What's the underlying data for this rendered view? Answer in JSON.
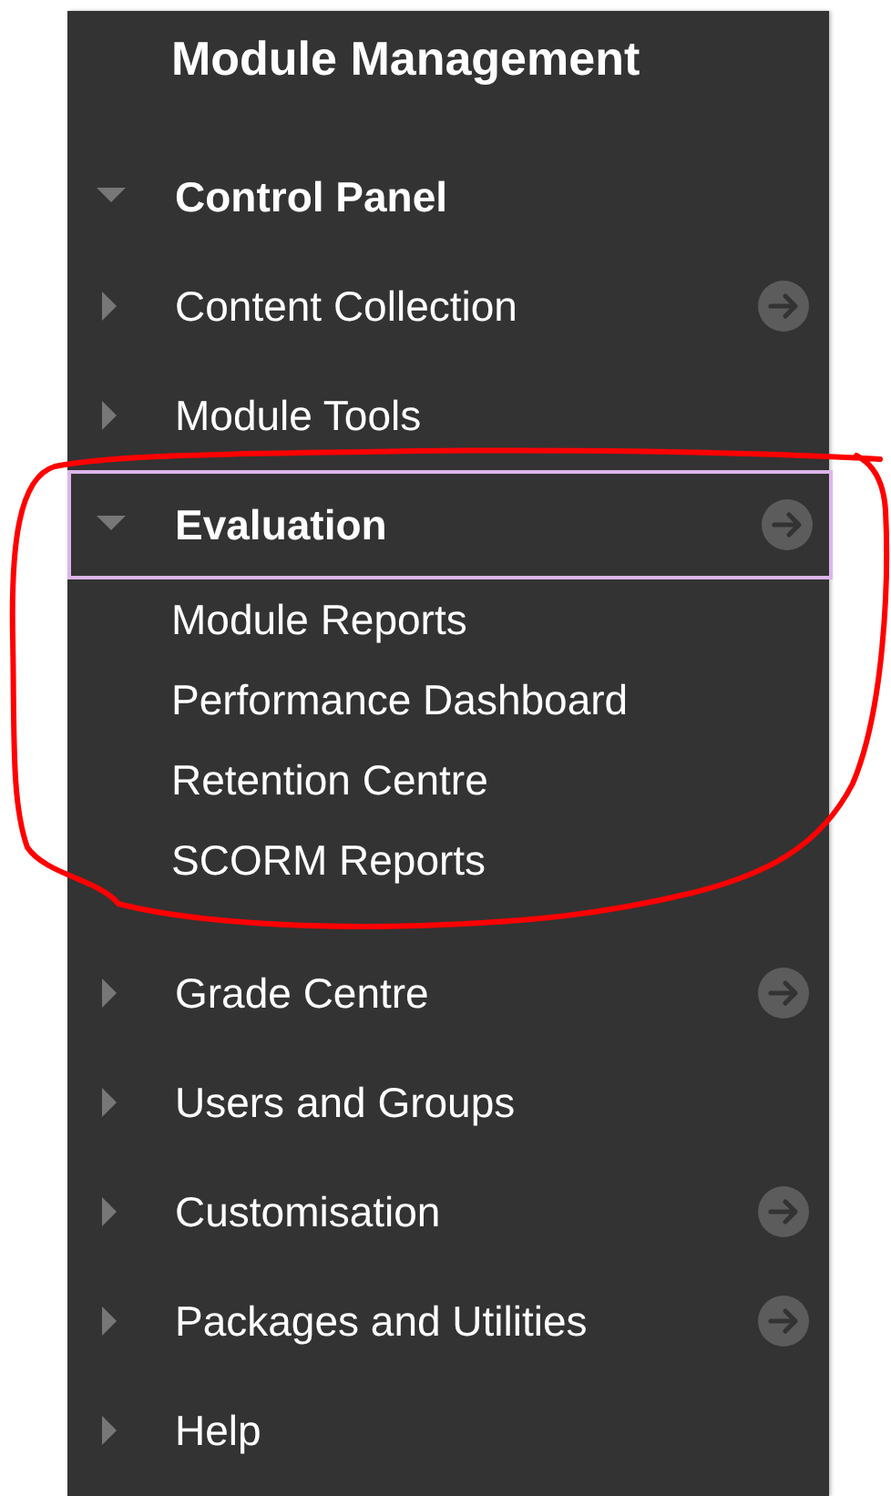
{
  "panel": {
    "title": "Module Management",
    "section": {
      "label": "Control Panel",
      "expanded": true,
      "items": [
        {
          "label": "Content Collection",
          "expanded": false,
          "focused": false,
          "has_link": true
        },
        {
          "label": "Module Tools",
          "expanded": false,
          "focused": false,
          "has_link": false
        },
        {
          "label": "Evaluation",
          "expanded": true,
          "focused": true,
          "has_link": true,
          "children": [
            {
              "label": "Module Reports"
            },
            {
              "label": "Performance Dashboard"
            },
            {
              "label": "Retention Centre"
            },
            {
              "label": "SCORM Reports"
            }
          ]
        },
        {
          "label": "Grade Centre",
          "expanded": false,
          "focused": false,
          "has_link": true
        },
        {
          "label": "Users and Groups",
          "expanded": false,
          "focused": false,
          "has_link": false
        },
        {
          "label": "Customisation",
          "expanded": false,
          "focused": false,
          "has_link": true
        },
        {
          "label": "Packages and Utilities",
          "expanded": false,
          "focused": false,
          "has_link": true
        },
        {
          "label": "Help",
          "expanded": false,
          "focused": false,
          "has_link": false
        }
      ]
    }
  },
  "annotation": {
    "kind": "loop"
  }
}
